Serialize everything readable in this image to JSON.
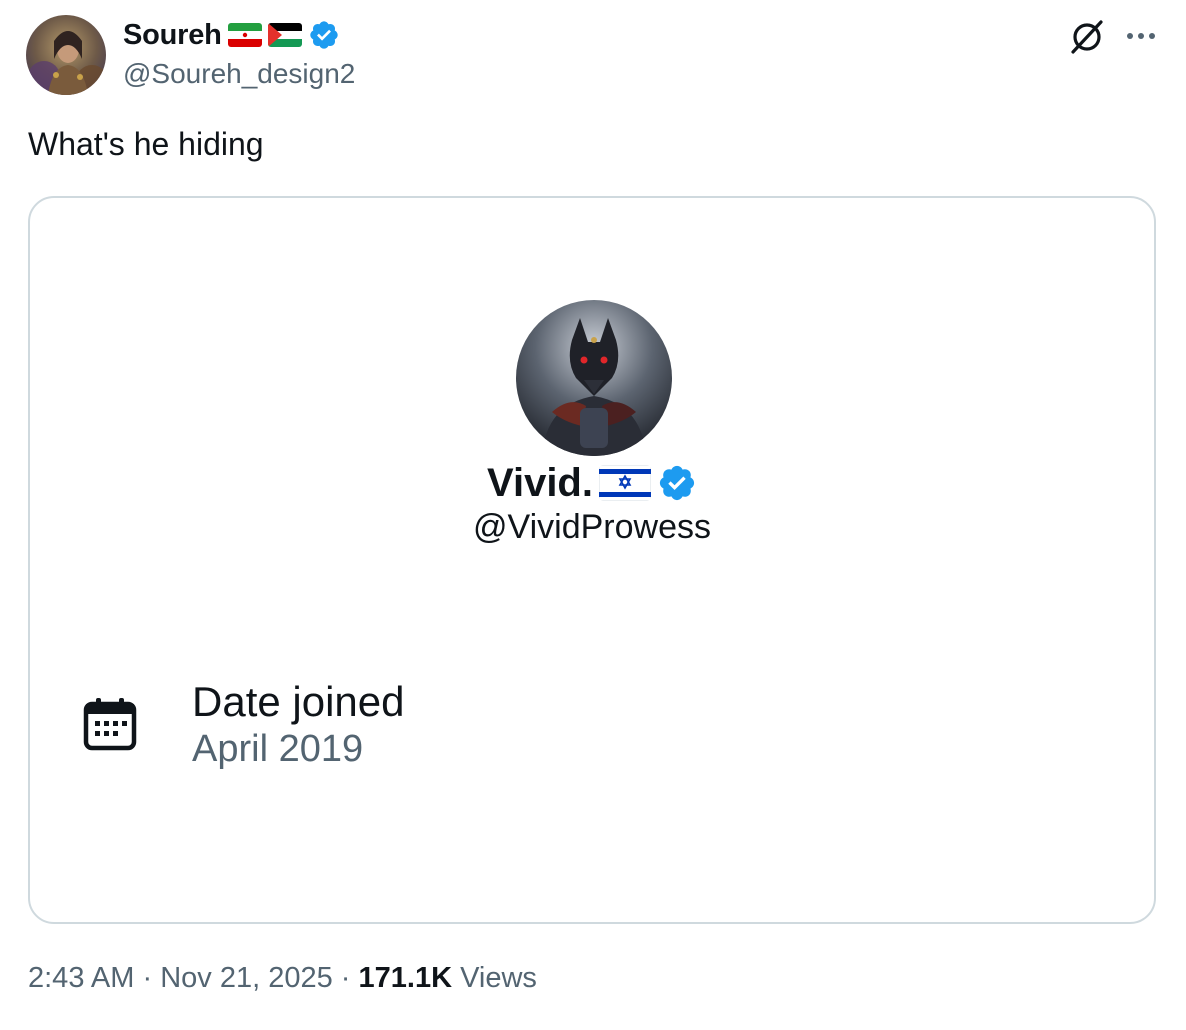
{
  "author": {
    "display_name": "Soureh",
    "handle": "@Soureh_design2",
    "flags": [
      "iran-flag-icon",
      "palestine-flag-icon"
    ],
    "verified": true
  },
  "tweet": {
    "text": "What's he hiding"
  },
  "card": {
    "display_name": "Vivid.",
    "flag": "israel-flag-icon",
    "verified": true,
    "handle": "@VividProwess",
    "joined_label": "Date joined",
    "joined_value": "April 2019"
  },
  "meta": {
    "time": "2:43 AM",
    "separator": "·",
    "date": "Nov 21, 2025",
    "views_count": "171.1K",
    "views_label": "Views"
  },
  "colors": {
    "text_primary": "#0f1419",
    "text_secondary": "#536471",
    "verified_blue": "#1d9bf0",
    "border": "#cfd9de"
  }
}
